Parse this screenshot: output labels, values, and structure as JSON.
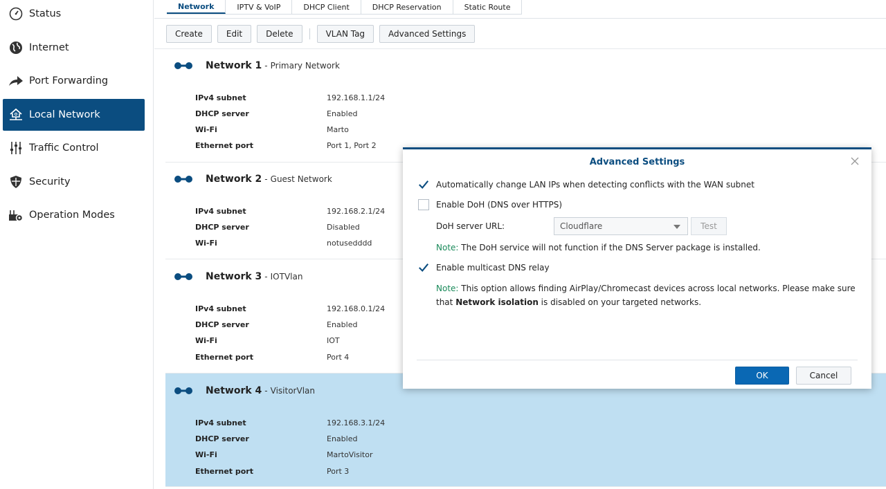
{
  "sidebar": {
    "items": [
      {
        "label": "Status",
        "icon": "status-gauge-icon"
      },
      {
        "label": "Internet",
        "icon": "globe-icon"
      },
      {
        "label": "Port Forwarding",
        "icon": "forward-arrow-icon"
      },
      {
        "label": "Local Network",
        "icon": "home-network-icon",
        "active": true
      },
      {
        "label": "Traffic Control",
        "icon": "sliders-icon"
      },
      {
        "label": "Security",
        "icon": "shield-icon"
      },
      {
        "label": "Operation Modes",
        "icon": "router-gear-icon"
      }
    ]
  },
  "tabs": [
    "Network",
    "IPTV & VoIP",
    "DHCP Client",
    "DHCP Reservation",
    "Static Route"
  ],
  "toolbar": {
    "create": "Create",
    "edit": "Edit",
    "delete": "Delete",
    "vlan": "VLAN Tag",
    "advanced": "Advanced Settings"
  },
  "labels": {
    "ipv4": "IPv4 subnet",
    "dhcp": "DHCP server",
    "wifi": "Wi-Fi",
    "eth": "Ethernet port",
    "sep": "-"
  },
  "networks": [
    {
      "name": "Network 1",
      "desc": "Primary Network",
      "ipv4": "192.168.1.1/24",
      "dhcp": "Enabled",
      "wifi": "Marto",
      "eth": "Port 1, Port 2"
    },
    {
      "name": "Network 2",
      "desc": "Guest Network",
      "ipv4": "192.168.2.1/24",
      "dhcp": "Disabled",
      "wifi": "notusedddd"
    },
    {
      "name": "Network 3",
      "desc": "IOTVlan",
      "ipv4": "192.168.0.1/24",
      "dhcp": "Enabled",
      "wifi": "IOT",
      "eth": "Port 4"
    },
    {
      "name": "Network 4",
      "desc": "VisitorVlan",
      "ipv4": "192.168.3.1/24",
      "dhcp": "Enabled",
      "wifi": "MartoVisitor",
      "eth": "Port 3",
      "selected": true
    }
  ],
  "modal": {
    "title": "Advanced Settings",
    "auto_lan": "Automatically change LAN IPs when detecting conflicts with the WAN subnet",
    "auto_lan_checked": true,
    "doh": "Enable DoH (DNS over HTTPS)",
    "doh_checked": false,
    "doh_url_label": "DoH server URL:",
    "doh_url_value": "Cloudflare",
    "test": "Test",
    "note_key": "Note:",
    "doh_note": " The DoH service will not function if the DNS Server package is installed.",
    "mdns": "Enable multicast DNS relay",
    "mdns_checked": true,
    "mdns_note_1": " This option allows finding AirPlay/Chromecast devices across local networks. Please make sure",
    "mdns_note_2a": "that ",
    "mdns_note_bold": "Network isolation",
    "mdns_note_2b": " is disabled on your targeted networks.",
    "ok": "OK",
    "cancel": "Cancel"
  },
  "colors": {
    "accent": "#0b4d80",
    "selected_row": "#bfdff2",
    "ok_button": "#0a68b4",
    "note_green": "#1a8a5a"
  }
}
